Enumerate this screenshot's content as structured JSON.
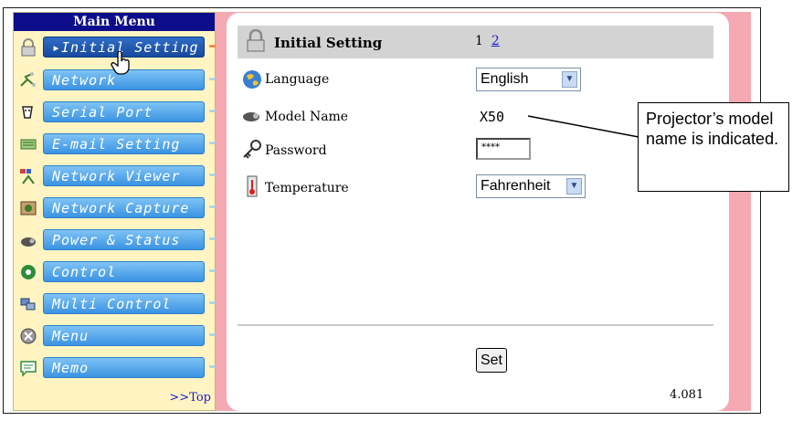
{
  "sidebar": {
    "title": "Main Menu",
    "items": [
      {
        "label": "Initial Setting",
        "icon": "lock-icon",
        "active": true
      },
      {
        "label": "Network",
        "icon": "network-icon",
        "active": false
      },
      {
        "label": "Serial Port",
        "icon": "serial-port-icon",
        "active": false
      },
      {
        "label": "E-mail Setting",
        "icon": "email-icon",
        "active": false
      },
      {
        "label": "Network Viewer",
        "icon": "network-viewer-icon",
        "active": false
      },
      {
        "label": "Network Capture",
        "icon": "network-capture-icon",
        "active": false
      },
      {
        "label": "Power & Status",
        "icon": "projector-icon",
        "active": false
      },
      {
        "label": "Control",
        "icon": "control-icon",
        "active": false
      },
      {
        "label": "Multi Control",
        "icon": "multi-control-icon",
        "active": false
      },
      {
        "label": "Menu",
        "icon": "menu-icon",
        "active": false
      },
      {
        "label": "Memo",
        "icon": "memo-icon",
        "active": false
      }
    ],
    "top_link": ">>Top"
  },
  "main": {
    "title": "Initial Setting",
    "page_current": "1",
    "page_link": "2",
    "language_label": "Language",
    "language_value": "English",
    "model_label": "Model Name",
    "model_value": "X50",
    "password_label": "Password",
    "password_value": "****",
    "temperature_label": "Temperature",
    "temperature_value": "Fahrenheit",
    "set_label": "Set",
    "version": "4.081"
  },
  "callout": {
    "text": "Projector’s model name is indicated."
  },
  "colors": {
    "menu_title_bg": "#0d0d8c",
    "menu_btn": "#3a93e3",
    "menu_btn_active": "#174a9c",
    "sidebar_bg": "#fff4c2",
    "pink_frame": "#f4a9b3",
    "active_arrow": "#f06a1a"
  }
}
